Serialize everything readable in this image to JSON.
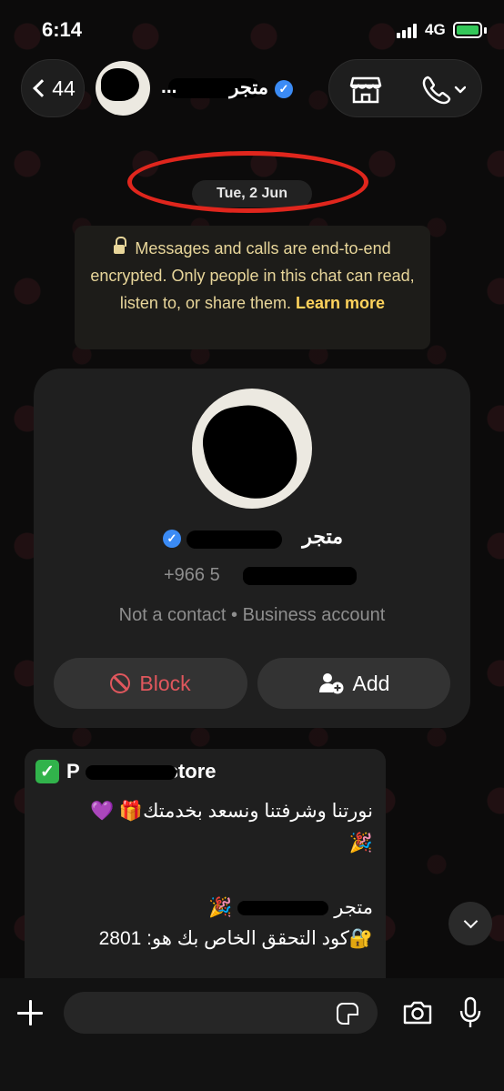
{
  "status_bar": {
    "time": "6:14",
    "network": "4G"
  },
  "header": {
    "back_count": "44",
    "contact_name": "متجر",
    "name_ellipsis": "..."
  },
  "chat": {
    "date_label": "Tue, 2 Jun",
    "encryption_text": "Messages and calls are end-to-end encrypted. Only people in this chat can read, listen to, or share them.",
    "learn_more": "Learn more"
  },
  "contact_card": {
    "name": "متجر",
    "phone": "+966 5",
    "meta": "Not a contact • Business account",
    "block_label": "Block",
    "add_label": "Add"
  },
  "message": {
    "title_prefix": "P",
    "title_suffix": "store",
    "line1": "نورتنا وشرفتنا ونسعد بخدمتك🎁 💜",
    "line2": "🎉",
    "line3_prefix": "متجر",
    "line3_suffix": "🎉",
    "line4": "🔐كود التحقق الخاص بك هو: 2801"
  },
  "input": {
    "placeholder": ""
  },
  "colors": {
    "accent_blue": "#3b8bf5",
    "encryption_text": "#e8d69a",
    "block_red": "#e0575d",
    "annotation_red": "#e0261d",
    "battery_green": "#34c759"
  },
  "icons": {
    "back": "chevron-left-icon",
    "store": "storefront-icon",
    "call": "phone-icon",
    "lock": "lock-icon",
    "block": "block-icon",
    "add": "add-user-icon",
    "check": "check-box-icon",
    "scroll": "chevron-down-icon",
    "plus": "plus-icon",
    "sticker": "sticker-icon",
    "camera": "camera-icon",
    "mic": "microphone-icon"
  }
}
